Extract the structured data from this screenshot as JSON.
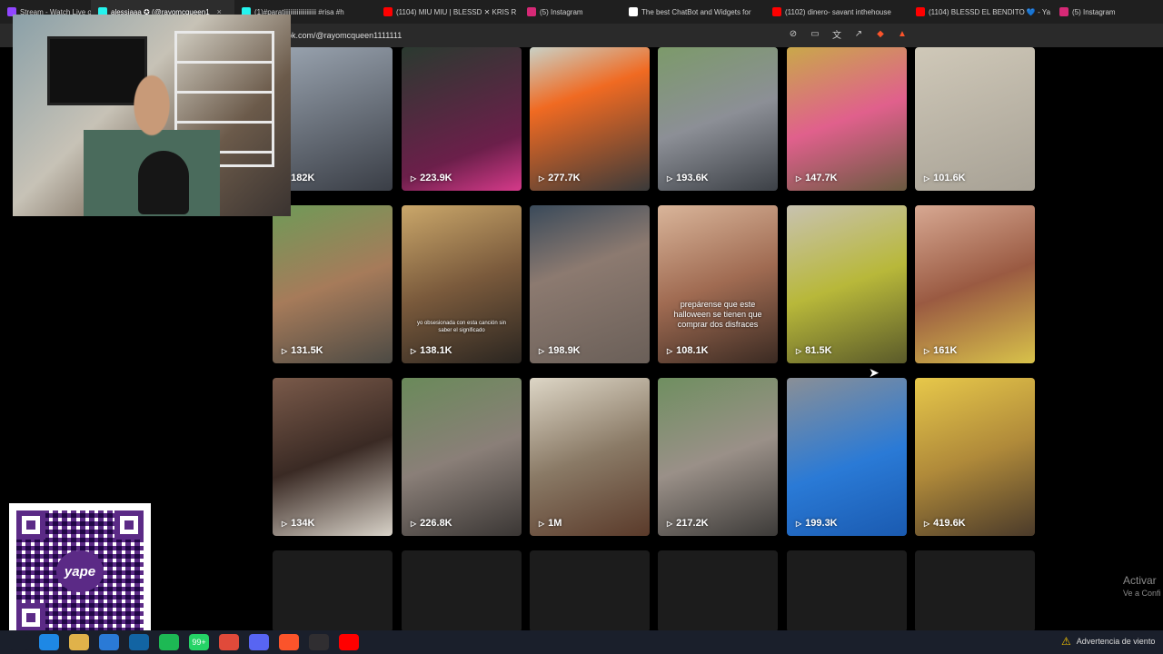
{
  "browser": {
    "tabs": [
      {
        "label": "Stream - Watch Live on",
        "color": "#9146ff",
        "active": false
      },
      {
        "label": "alessiaaa ✪ (@rayomcqueen1",
        "color": "#25f4ee",
        "active": true
      },
      {
        "label": "(1)#paratiiiiiiiiiiiiiiiiiiii #risa #h",
        "color": "#25f4ee",
        "active": false
      },
      {
        "label": "(1104) MIU MIU | BLESSD ✕ KRIS R",
        "color": "#ff0000",
        "active": false
      },
      {
        "label": "(5) Instagram",
        "color": "#d62976",
        "active": false
      },
      {
        "label": "The best ChatBot and Widgets for",
        "color": "#ffffff",
        "active": false
      },
      {
        "label": "(1102) dinero- savant inthehouse",
        "color": "#ff0000",
        "active": false
      },
      {
        "label": "(1104) BLESSD EL BENDITO 💙 - Ya",
        "color": "#ff0000",
        "active": false
      },
      {
        "label": "(5) Instagram",
        "color": "#d62976",
        "active": false
      }
    ],
    "tab_close": "×",
    "url": "ok.com/@rayomcqueen1111111",
    "toolbar_icons": [
      "reader-off-icon",
      "screen-icon",
      "translate-icon",
      "share-icon",
      "brave-shield-icon",
      "brave-rewards-icon"
    ]
  },
  "videos": [
    {
      "views": "182K",
      "bg": "linear-gradient(160deg,#9aa4b0,#3a3e46)",
      "caption": ""
    },
    {
      "views": "223.9K",
      "bg": "linear-gradient(160deg,#2b3a30,#6b1f4a 70%,#d63a8a)",
      "caption": ""
    },
    {
      "views": "277.7K",
      "bg": "linear-gradient(160deg,#c9d1c6,#f06a22 35%,#3a3a3a)",
      "caption": ""
    },
    {
      "views": "193.6K",
      "bg": "linear-gradient(160deg,#7c9a6a,#8c8f96 50%,#3c4046)",
      "caption": ""
    },
    {
      "views": "147.7K",
      "bg": "linear-gradient(160deg,#c9a84a,#e0608c 50%,#6a5a40)",
      "caption": ""
    },
    {
      "views": "101.6K",
      "bg": "linear-gradient(160deg,#cfc8b8,#a7a195)",
      "caption": ""
    },
    {
      "views": "131.5K",
      "bg": "linear-gradient(160deg,#6f9a58,#a67b5a 50%,#4c4a44)",
      "caption": ""
    },
    {
      "views": "138.1K",
      "bg": "linear-gradient(160deg,#caa76a,#7a5a3c 50%,#2a2520)",
      "caption": "yo obsesionada con esta canción sin saber el significado"
    },
    {
      "views": "198.9K",
      "bg": "linear-gradient(160deg,#3a4a5a,#8c7a70 40%,#6a5f58)",
      "caption": ""
    },
    {
      "views": "108.1K",
      "bg": "linear-gradient(160deg,#d9b59a,#a06b52 50%,#3a2a22)",
      "caption": "prepárense que este halloween se tienen que comprar dos disfraces"
    },
    {
      "views": "81.5K",
      "bg": "linear-gradient(160deg,#c8c2b0,#b8b83a 50%,#5a5a2a)",
      "caption": ""
    },
    {
      "views": "161K",
      "bg": "linear-gradient(160deg,#d7a892,#9a5a42 50%,#d8c24a)",
      "caption": ""
    },
    {
      "views": "134K",
      "bg": "linear-gradient(160deg,#7a5a4a,#3a2a24 50%,#d8d2c8)",
      "caption": ""
    },
    {
      "views": "226.8K",
      "bg": "linear-gradient(160deg,#6a8a5a,#8a7f78 50%,#3a3634)",
      "caption": ""
    },
    {
      "views": "1M",
      "bg": "linear-gradient(160deg,#ddd6c6,#8a7a66 50%,#5a3a2a)",
      "caption": ""
    },
    {
      "views": "217.2K",
      "bg": "linear-gradient(160deg,#6f8f60,#9a9088 50%,#3c3a38)",
      "caption": ""
    },
    {
      "views": "199.3K",
      "bg": "linear-gradient(160deg,#8a8f96,#2a7ad6 55%,#1a5ab0)",
      "caption": ""
    },
    {
      "views": "419.6K",
      "bg": "linear-gradient(160deg,#e7c84a,#b08a3a 50%,#4a3a2a)",
      "caption": ""
    }
  ],
  "watermark": {
    "line1": "Activar",
    "line2": "Ve a Confi"
  },
  "qr": {
    "logo_text": "yape"
  },
  "taskbar": {
    "icons": [
      {
        "name": "windows-icon",
        "label": "",
        "color": "#1a1f2b"
      },
      {
        "name": "edge-icon",
        "label": "",
        "color": "#1e88e5"
      },
      {
        "name": "explorer-icon",
        "label": "",
        "color": "#e0b24a"
      },
      {
        "name": "store-icon",
        "label": "",
        "color": "#2a7ad6"
      },
      {
        "name": "outlook-icon",
        "label": "",
        "color": "#1264a3"
      },
      {
        "name": "spotify-icon",
        "label": "",
        "color": "#1db954"
      },
      {
        "name": "whatsapp-icon",
        "label": "99+",
        "color": "#25d366"
      },
      {
        "name": "chrome-icon",
        "label": "",
        "color": "#e04a3a"
      },
      {
        "name": "discord-icon",
        "label": "",
        "color": "#5865f2"
      },
      {
        "name": "brave-icon",
        "label": "",
        "color": "#fb542b"
      },
      {
        "name": "obs-icon",
        "label": "",
        "color": "#302e31"
      },
      {
        "name": "youtube-icon",
        "label": "",
        "color": "#ff0000"
      }
    ],
    "weather_text": "Advertencia de viento"
  }
}
